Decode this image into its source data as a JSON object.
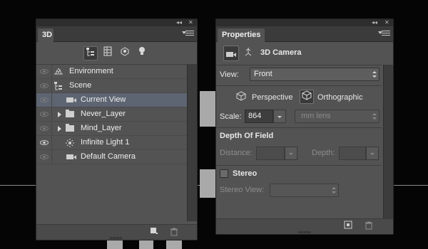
{
  "panel_3d": {
    "tab_label": "3D",
    "collapse_glyph": "◂◂",
    "close_glyph": "✕",
    "toolbar_icons": [
      "whole-scene-filter-icon",
      "meshes-filter-icon",
      "materials-filter-icon",
      "lights-filter-icon"
    ],
    "layers": [
      {
        "name": "Environment",
        "icon": "environment-icon",
        "visible": false,
        "expandable": false,
        "indent": 0,
        "selected": false
      },
      {
        "name": "Scene",
        "icon": "scene-icon",
        "visible": false,
        "expandable": false,
        "indent": 0,
        "selected": false
      },
      {
        "name": "Current View",
        "icon": "camera-icon",
        "visible": false,
        "expandable": false,
        "indent": 1,
        "selected": true
      },
      {
        "name": "Never_Layer",
        "icon": "folder-icon",
        "visible": false,
        "expandable": true,
        "indent": 1,
        "selected": false
      },
      {
        "name": "Mind_Layer",
        "icon": "folder-icon",
        "visible": false,
        "expandable": true,
        "indent": 1,
        "selected": false
      },
      {
        "name": "Infinite Light 1",
        "icon": "light-icon",
        "visible": true,
        "expandable": false,
        "indent": 1,
        "selected": false
      },
      {
        "name": "Default Camera",
        "icon": "camera-icon",
        "visible": false,
        "expandable": false,
        "indent": 1,
        "selected": false
      }
    ],
    "bottom_icons": [
      "add-object-icon",
      "delete-icon"
    ]
  },
  "panel_properties": {
    "tab_label": "Properties",
    "collapse_glyph": "◂◂",
    "close_glyph": "✕",
    "header_title": "3D Camera",
    "view": {
      "label": "View:",
      "value": "Front"
    },
    "perspective_label": "Perspective",
    "orthographic_label": "Orthographic",
    "scale": {
      "label": "Scale:",
      "value": "864",
      "unit_placeholder": "mm lens"
    },
    "dof": {
      "title": "Depth Of Field",
      "distance_label": "Distance:",
      "depth_label": "Depth:"
    },
    "stereo": {
      "title": "Stereo",
      "view_label": "Stereo View:",
      "checked": false
    },
    "bottom_icons": [
      "render-icon",
      "delete-icon"
    ]
  }
}
